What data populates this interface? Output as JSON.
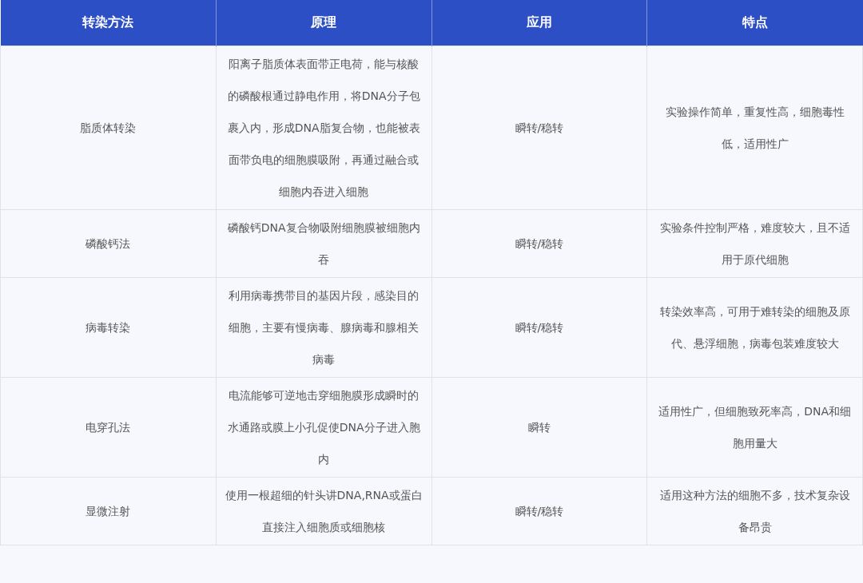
{
  "table": {
    "columns": [
      "转染方法",
      "原理",
      "应用",
      "特点"
    ],
    "rows": [
      [
        "脂质体转染",
        "阳离子脂质体表面带正电荷，能与核酸的磷酸根通过静电作用，将DNA分子包裹入内，形成DNA脂复合物，也能被表面带负电的细胞膜吸附，再通过融合或细胞内吞进入细胞",
        "瞬转/稳转",
        "实验操作简单，重复性高，细胞毒性低，适用性广"
      ],
      [
        "磷酸钙法",
        "磷酸钙DNA复合物吸附细胞膜被细胞内吞",
        "瞬转/稳转",
        "实验条件控制严格，难度较大，且不适用于原代细胞"
      ],
      [
        "病毒转染",
        "利用病毒携带目的基因片段，感染目的细胞，主要有慢病毒、腺病毒和腺相关病毒",
        "瞬转/稳转",
        "转染效率高，可用于难转染的细胞及原代、悬浮细胞，病毒包装难度较大"
      ],
      [
        "电穿孔法",
        "电流能够可逆地击穿细胞膜形成瞬时的水通路或膜上小孔促使DNA分子进入胞内",
        "瞬转",
        "适用性广，但细胞致死率高，DNA和细胞用量大"
      ],
      [
        "显微注射",
        "使用一根超细的针头讲DNA,RNA或蛋白直接注入细胞质或细胞核",
        "瞬转/稳转",
        "适用这种方法的细胞不多，技术复杂设备昂贵"
      ]
    ]
  }
}
